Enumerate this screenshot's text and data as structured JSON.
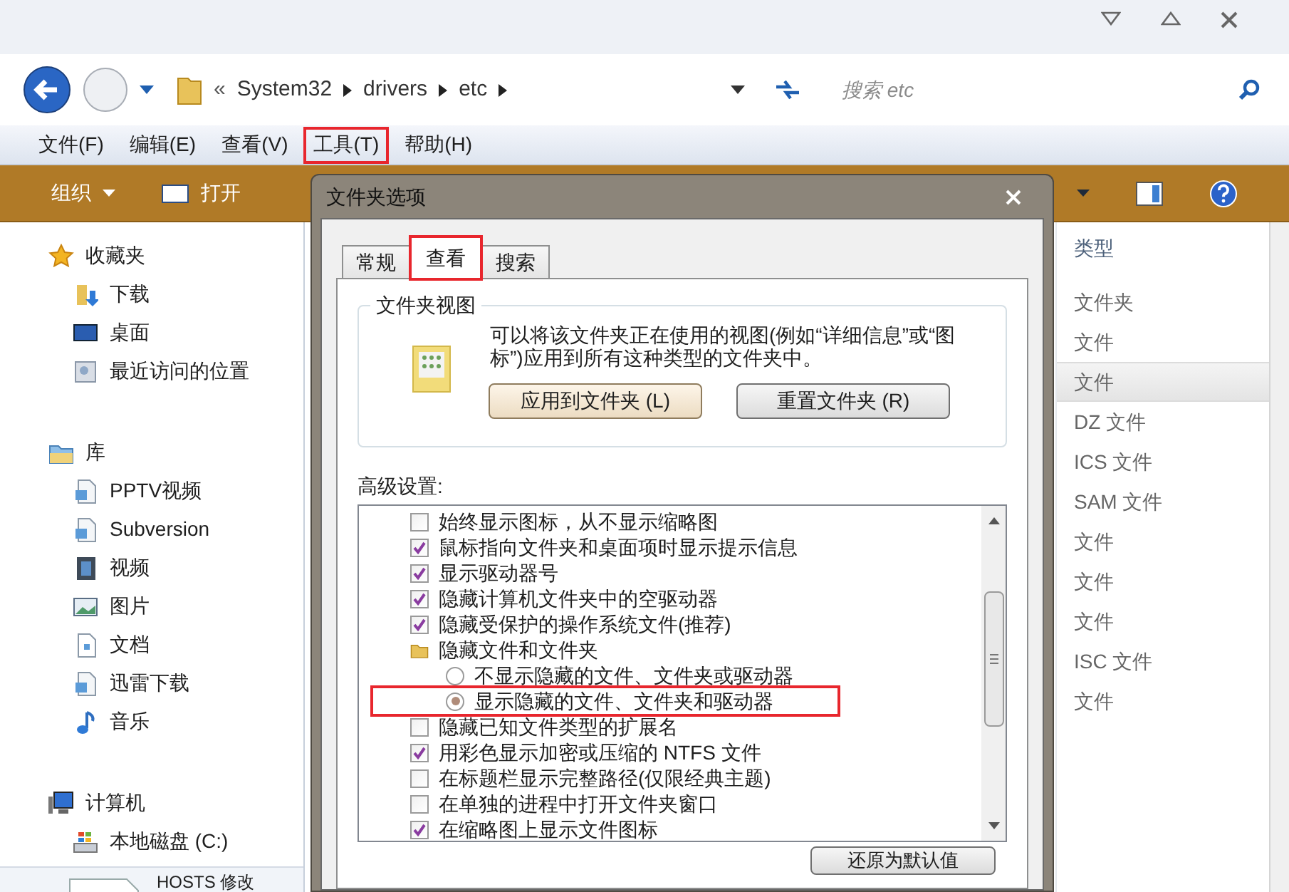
{
  "address_bar": {
    "overflow": "«",
    "path": [
      "System32",
      "drivers",
      "etc"
    ],
    "search": {
      "placeholder": "搜索 etc"
    }
  },
  "menu": [
    {
      "label": "文件(F)",
      "highlighted": false
    },
    {
      "label": "编辑(E)",
      "highlighted": false
    },
    {
      "label": "查看(V)",
      "highlighted": false
    },
    {
      "label": "工具(T)",
      "highlighted": true
    },
    {
      "label": "帮助(H)",
      "highlighted": false
    }
  ],
  "toolbar": {
    "organize": "组织",
    "open": "打开"
  },
  "sidebar": [
    {
      "label": "收藏夹",
      "kind": "star",
      "children": [
        {
          "label": "下载",
          "kind": "download"
        },
        {
          "label": "桌面",
          "kind": "desktop"
        },
        {
          "label": "最近访问的位置",
          "kind": "recent"
        }
      ]
    },
    {
      "label": "库",
      "kind": "library",
      "children": [
        {
          "label": "PPTV视频",
          "kind": "libdoc"
        },
        {
          "label": "Subversion",
          "kind": "libdoc"
        },
        {
          "label": "视频",
          "kind": "film"
        },
        {
          "label": "图片",
          "kind": "picture"
        },
        {
          "label": "文档",
          "kind": "document"
        },
        {
          "label": "迅雷下载",
          "kind": "libdoc"
        },
        {
          "label": "音乐",
          "kind": "music"
        }
      ]
    },
    {
      "label": "计算机",
      "kind": "computer",
      "children": [
        {
          "label": "本地磁盘 (C:)",
          "kind": "drive"
        }
      ]
    }
  ],
  "file_list": {
    "column": "类型",
    "rows": [
      {
        "type": "文件夹",
        "selected": false
      },
      {
        "type": "文件",
        "selected": false
      },
      {
        "type": "文件",
        "selected": true
      },
      {
        "type": "DZ 文件",
        "selected": false
      },
      {
        "type": "ICS 文件",
        "selected": false
      },
      {
        "type": "SAM 文件",
        "selected": false
      },
      {
        "type": "文件",
        "selected": false
      },
      {
        "type": "文件",
        "selected": false
      },
      {
        "type": "文件",
        "selected": false
      },
      {
        "type": "ISC 文件",
        "selected": false
      },
      {
        "type": "文件",
        "selected": false
      }
    ]
  },
  "details": {
    "name": "HOSTS 修改"
  },
  "dialog": {
    "title": "文件夹选项",
    "tabs": [
      {
        "label": "常规",
        "selected": false,
        "highlighted": false
      },
      {
        "label": "查看",
        "selected": true,
        "highlighted": true
      },
      {
        "label": "搜索",
        "selected": false,
        "highlighted": false
      }
    ],
    "folder_views": {
      "legend": "文件夹视图",
      "description": "可以将该文件夹正在使用的视图(例如“详细信息”或“图标”)应用到所有这种类型的文件夹中。",
      "buttons": [
        "应用到文件夹 (L)",
        "重置文件夹 (R)"
      ]
    },
    "advanced": {
      "label": "高级设置:",
      "items": [
        {
          "kind": "checkbox",
          "label": "始终显示图标，从不显示缩略图",
          "checked": false
        },
        {
          "kind": "checkbox",
          "label": "鼠标指向文件夹和桌面项时显示提示信息",
          "checked": true
        },
        {
          "kind": "checkbox",
          "label": "显示驱动器号",
          "checked": true
        },
        {
          "kind": "checkbox",
          "label": "隐藏计算机文件夹中的空驱动器",
          "checked": true
        },
        {
          "kind": "checkbox",
          "label": "隐藏受保护的操作系统文件(推荐)",
          "checked": true
        },
        {
          "kind": "folder",
          "label": "隐藏文件和文件夹",
          "children": [
            {
              "kind": "radio",
              "label": "不显示隐藏的文件、文件夹或驱动器",
              "checked": false,
              "highlighted": false
            },
            {
              "kind": "radio",
              "label": "显示隐藏的文件、文件夹和驱动器",
              "checked": true,
              "highlighted": true
            }
          ]
        },
        {
          "kind": "checkbox",
          "label": "隐藏已知文件类型的扩展名",
          "checked": false
        },
        {
          "kind": "checkbox",
          "label": "用彩色显示加密或压缩的 NTFS 文件",
          "checked": true
        },
        {
          "kind": "checkbox",
          "label": "在标题栏显示完整路径(仅限经典主题)",
          "checked": false
        },
        {
          "kind": "checkbox",
          "label": "在单独的进程中打开文件夹窗口",
          "checked": false
        },
        {
          "kind": "checkbox",
          "label": "在缩略图上显示文件图标",
          "checked": true
        }
      ]
    },
    "restore_button": "还原为默认值"
  }
}
